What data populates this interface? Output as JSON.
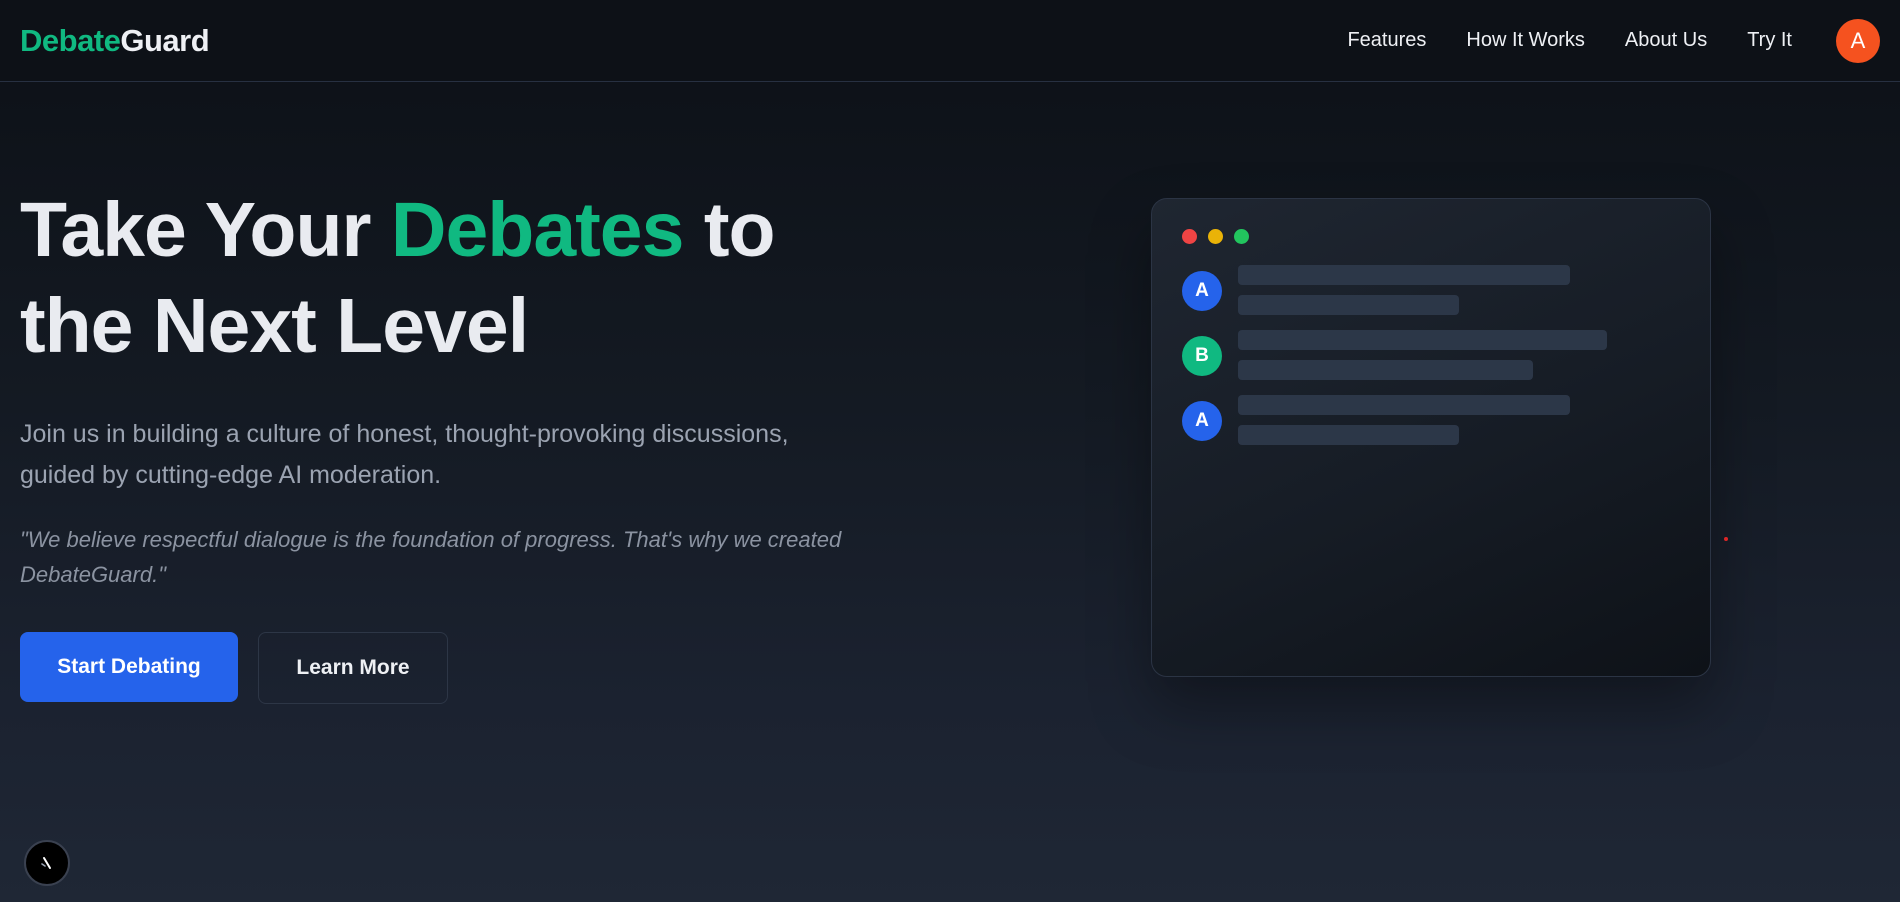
{
  "header": {
    "logo_part1": "Debate",
    "logo_part2": "Guard",
    "nav": [
      "Features",
      "How It Works",
      "About Us",
      "Try It"
    ],
    "avatar_letter": "A"
  },
  "hero": {
    "title_part1": "Take Your ",
    "title_accent": "Debates",
    "title_part2": " to the Next Level",
    "subtitle": "Join us in building a culture of honest, thought-provoking discussions, guided by cutting-edge AI moderation.",
    "quote": "\"We believe respectful dialogue is the foundation of progress. That's why we created DebateGuard.\"",
    "primary_button": "Start Debating",
    "secondary_button": "Learn More"
  },
  "mock_window": {
    "dot_colors": [
      "#ef4444",
      "#eab308",
      "#22c55e"
    ],
    "messages": [
      {
        "speaker": "A",
        "color": "#2563eb"
      },
      {
        "speaker": "B",
        "color": "#10b981"
      },
      {
        "speaker": "A",
        "color": "#2563eb"
      }
    ]
  },
  "colors": {
    "accent_green": "#10b981",
    "primary_blue": "#2563eb",
    "avatar_orange": "#f5521f"
  }
}
